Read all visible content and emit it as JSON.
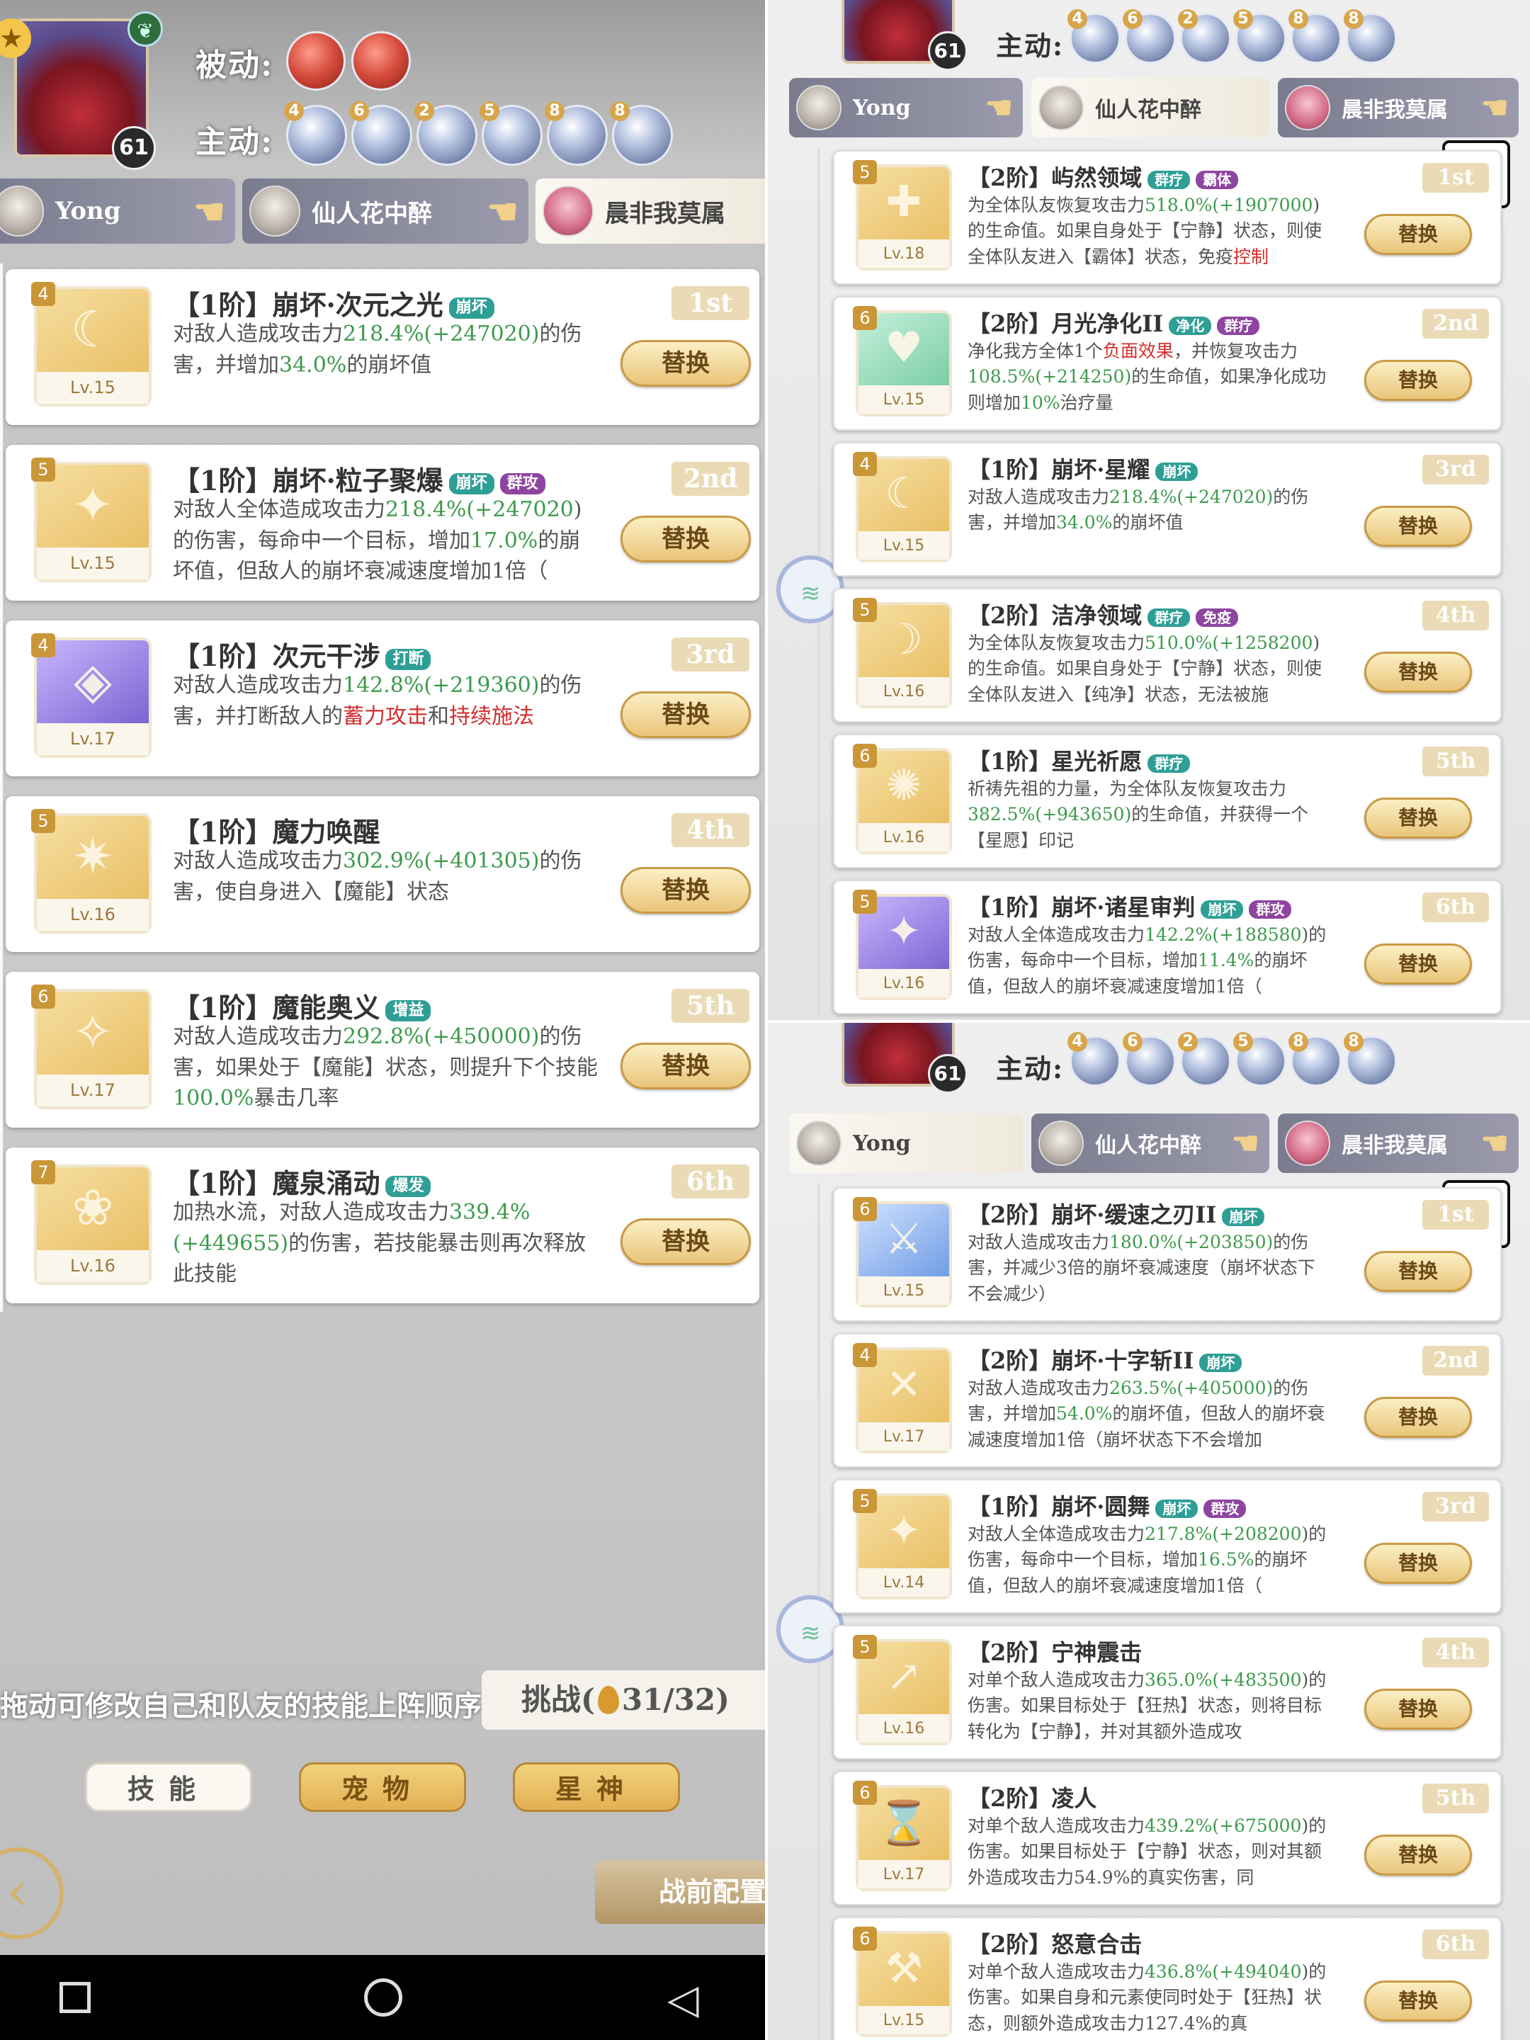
{
  "panelA": {
    "passive_label": "被动:",
    "active_label": "主动:",
    "avatar_level": "61",
    "active_orb_numbers": [
      "4",
      "6",
      "2",
      "5",
      "8",
      "8"
    ],
    "team_tabs": [
      "Yong",
      "仙人花中醉",
      "晨非我莫属"
    ],
    "skills": [
      {
        "tier": "4",
        "level": "Lv.15",
        "name": "【1阶】崩坏·次元之光",
        "tags": [
          "崩坏"
        ],
        "rank": "1st",
        "desc": [
          {
            "t": "对敌人造成攻击力"
          },
          {
            "t": "218.4%",
            "c": "g"
          },
          {
            "t": "(+247020)",
            "c": "g"
          },
          {
            "t": "的伤害，并增加"
          },
          {
            "t": "34.0%",
            "c": "g"
          },
          {
            "t": "的崩坏值"
          }
        ]
      },
      {
        "tier": "5",
        "level": "Lv.15",
        "name": "【1阶】崩坏·粒子聚爆",
        "tags": [
          "崩坏",
          "群攻"
        ],
        "rank": "2nd",
        "desc": [
          {
            "t": "对敌人全体造成攻击力"
          },
          {
            "t": "218.4%",
            "c": "g"
          },
          {
            "t": "(+247020",
            "c": "g"
          },
          {
            "t": ")的伤害，每命中一个目标，增加"
          },
          {
            "t": "17.0%",
            "c": "g"
          },
          {
            "t": "的崩坏值，但敌人的崩坏衰减速度增加1倍（"
          }
        ]
      },
      {
        "tier": "4",
        "level": "Lv.17",
        "name": "【1阶】次元干涉",
        "tags": [
          "打断"
        ],
        "rank": "3rd",
        "desc": [
          {
            "t": "对敌人造成攻击力"
          },
          {
            "t": "142.8%",
            "c": "g"
          },
          {
            "t": "(+219360)",
            "c": "g"
          },
          {
            "t": "的伤害，并打断敌人的"
          },
          {
            "t": "蓄力攻击",
            "c": "r"
          },
          {
            "t": "和"
          },
          {
            "t": "持续施法",
            "c": "r"
          }
        ]
      },
      {
        "tier": "5",
        "level": "Lv.16",
        "name": "【1阶】魔力唤醒",
        "tags": [],
        "rank": "4th",
        "desc": [
          {
            "t": "对敌人造成攻击力"
          },
          {
            "t": "302.9%",
            "c": "g"
          },
          {
            "t": "(+401305)",
            "c": "g"
          },
          {
            "t": "的伤害，使自身进入【魔能】状态"
          }
        ]
      },
      {
        "tier": "6",
        "level": "Lv.17",
        "name": "【1阶】魔能奥义",
        "tags": [
          "增益"
        ],
        "rank": "5th",
        "desc": [
          {
            "t": "对敌人造成攻击力"
          },
          {
            "t": "292.8%",
            "c": "g"
          },
          {
            "t": "(+450000)",
            "c": "g"
          },
          {
            "t": "的伤害，如果处于【魔能】状态，则提升下个技能"
          },
          {
            "t": "100.0%",
            "c": "g"
          },
          {
            "t": "暴击几率"
          }
        ]
      },
      {
        "tier": "7",
        "level": "Lv.16",
        "name": "【1阶】魔泉涌动",
        "tags": [
          "爆发"
        ],
        "rank": "6th",
        "desc": [
          {
            "t": "加热水流，对敌人造成攻击力"
          },
          {
            "t": "339.4%",
            "c": "g"
          },
          {
            "t": "(+449655)",
            "c": "g"
          },
          {
            "t": "的伤害，若技能暴击则再次释放此技能"
          }
        ]
      }
    ],
    "swap_label": "替换",
    "hint": "拖动可修改自己和队友的技能上阵顺序",
    "challenge_prefix": "挑战(",
    "challenge_count": "31/32)",
    "bottom_tabs": [
      "技能",
      "宠物",
      "星神"
    ],
    "prep_label": "战前配置"
  },
  "panelB": {
    "active_label": "主动:",
    "avatar_level": "61",
    "active_orb_numbers": [
      "4",
      "6",
      "2",
      "5",
      "8",
      "8"
    ],
    "team_tabs": [
      "Yong",
      "仙人花中醉",
      "晨非我莫属"
    ],
    "skills": [
      {
        "tier": "5",
        "level": "Lv.18",
        "name": "【2阶】屿然领域",
        "tags": [
          "群疗",
          "霸体"
        ],
        "rank": "1st",
        "desc": [
          {
            "t": "为全体队友恢复攻击力"
          },
          {
            "t": "518.0%",
            "c": "g"
          },
          {
            "t": "(+1907000",
            "c": "g"
          },
          {
            "t": ")的生命值。如果自身处于【宁静】状态，则使全体队友进入【霸体】状态，免疫"
          },
          {
            "t": "控制",
            "c": "r"
          }
        ]
      },
      {
        "tier": "6",
        "level": "Lv.15",
        "name": "【2阶】月光净化II",
        "tags": [
          "净化",
          "群疗"
        ],
        "rank": "2nd",
        "desc": [
          {
            "t": "净化我方全体1个"
          },
          {
            "t": "负面效果",
            "c": "r"
          },
          {
            "t": "，并恢复攻击力"
          },
          {
            "t": "108.5%",
            "c": "g"
          },
          {
            "t": "(+214250)",
            "c": "g"
          },
          {
            "t": "的生命值，如果净化成功则增加"
          },
          {
            "t": "10%",
            "c": "g"
          },
          {
            "t": "治疗量"
          }
        ]
      },
      {
        "tier": "4",
        "level": "Lv.15",
        "name": "【1阶】崩坏·星耀",
        "tags": [
          "崩坏"
        ],
        "rank": "3rd",
        "desc": [
          {
            "t": "对敌人造成攻击力"
          },
          {
            "t": "218.4%",
            "c": "g"
          },
          {
            "t": "(+247020)",
            "c": "g"
          },
          {
            "t": "的伤害，并增加"
          },
          {
            "t": "34.0%",
            "c": "g"
          },
          {
            "t": "的崩坏值"
          }
        ]
      },
      {
        "tier": "5",
        "level": "Lv.16",
        "name": "【2阶】洁净领域",
        "tags": [
          "群疗",
          "免疫"
        ],
        "rank": "4th",
        "desc": [
          {
            "t": "为全体队友恢复攻击力"
          },
          {
            "t": "510.0%",
            "c": "g"
          },
          {
            "t": "(+1258200",
            "c": "g"
          },
          {
            "t": ")的生命值。如果自身处于【宁静】状态，则使全体队友进入【纯净】状态，无法被施"
          }
        ]
      },
      {
        "tier": "6",
        "level": "Lv.16",
        "name": "【1阶】星光祈愿",
        "tags": [
          "群疗"
        ],
        "rank": "5th",
        "desc": [
          {
            "t": "祈祷先祖的力量，为全体队友恢复攻击力"
          },
          {
            "t": "382.5%",
            "c": "g"
          },
          {
            "t": "(+943650)",
            "c": "g"
          },
          {
            "t": "的生命值，并获得一个【星愿】印记"
          }
        ]
      },
      {
        "tier": "5",
        "level": "Lv.16",
        "name": "【1阶】崩坏·诸星审判",
        "tags": [
          "崩坏",
          "群攻"
        ],
        "rank": "6th",
        "desc": [
          {
            "t": "对敌人全体造成攻击力"
          },
          {
            "t": "142.2%",
            "c": "g"
          },
          {
            "t": "(+188580",
            "c": "g"
          },
          {
            "t": ")的伤害，每命中一个目标，增加"
          },
          {
            "t": "11.4%",
            "c": "g"
          },
          {
            "t": "的崩坏值，但敌人的崩坏衰减速度增加1倍（"
          }
        ]
      }
    ],
    "swap_label": "替换"
  },
  "panelC": {
    "active_label": "主动:",
    "avatar_level": "61",
    "active_orb_numbers": [
      "4",
      "6",
      "2",
      "5",
      "8",
      "8"
    ],
    "team_tabs": [
      "Yong",
      "仙人花中醉",
      "晨非我莫属"
    ],
    "skills": [
      {
        "tier": "6",
        "level": "Lv.15",
        "name": "【2阶】崩坏·缓速之刃II",
        "tags": [
          "崩坏"
        ],
        "rank": "1st",
        "desc": [
          {
            "t": "对敌人造成攻击力"
          },
          {
            "t": "180.0%",
            "c": "g"
          },
          {
            "t": "(+203850)",
            "c": "g"
          },
          {
            "t": "的伤害，并减少3倍的崩坏衰减速度（崩坏状态下不会减少）"
          }
        ]
      },
      {
        "tier": "4",
        "level": "Lv.17",
        "name": "【2阶】崩坏·十字斩II",
        "tags": [
          "崩坏"
        ],
        "rank": "2nd",
        "desc": [
          {
            "t": "对敌人造成攻击力"
          },
          {
            "t": "263.5%",
            "c": "g"
          },
          {
            "t": "(+405000)",
            "c": "g"
          },
          {
            "t": "的伤害，并增加"
          },
          {
            "t": "54.0%",
            "c": "g"
          },
          {
            "t": "的崩坏值，但敌人的崩坏衰减速度增加1倍（崩坏状态下不会增加"
          }
        ]
      },
      {
        "tier": "5",
        "level": "Lv.14",
        "name": "【1阶】崩坏·圆舞",
        "tags": [
          "崩坏",
          "群攻"
        ],
        "rank": "3rd",
        "desc": [
          {
            "t": "对敌人全体造成攻击力"
          },
          {
            "t": "217.8%",
            "c": "g"
          },
          {
            "t": "(+208200",
            "c": "g"
          },
          {
            "t": ")的伤害，每命中一个目标，增加"
          },
          {
            "t": "16.5%",
            "c": "g"
          },
          {
            "t": "的崩坏值，但敌人的崩坏衰减速度增加1倍（"
          }
        ]
      },
      {
        "tier": "5",
        "level": "Lv.16",
        "name": "【2阶】宁神震击",
        "tags": [],
        "rank": "4th",
        "desc": [
          {
            "t": "对单个敌人造成攻击力"
          },
          {
            "t": "365.0%",
            "c": "g"
          },
          {
            "t": "(+483500",
            "c": "g"
          },
          {
            "t": ")的伤害。如果目标处于【狂热】状态，则将目标转化为【宁静】，并对其额外造成攻"
          }
        ]
      },
      {
        "tier": "6",
        "level": "Lv.17",
        "name": "【2阶】凌人",
        "tags": [],
        "rank": "5th",
        "desc": [
          {
            "t": "对单个敌人造成攻击力"
          },
          {
            "t": "439.2%",
            "c": "g"
          },
          {
            "t": "(+675000",
            "c": "g"
          },
          {
            "t": ")的伤害。如果目标处于【宁静】状态，则对其额外造成攻击力54.9%的真实伤害，同"
          }
        ]
      },
      {
        "tier": "6",
        "level": "Lv.15",
        "name": "【2阶】怒意合击",
        "tags": [],
        "rank": "6th",
        "desc": [
          {
            "t": "对单个敌人造成攻击力"
          },
          {
            "t": "436.8%",
            "c": "g"
          },
          {
            "t": "(+494040",
            "c": "g"
          },
          {
            "t": ")的伤害。如果自身和元素使同时处于【狂热】状态，则额外造成攻击力127.4%的真"
          }
        ]
      }
    ],
    "swap_label": "替换"
  }
}
